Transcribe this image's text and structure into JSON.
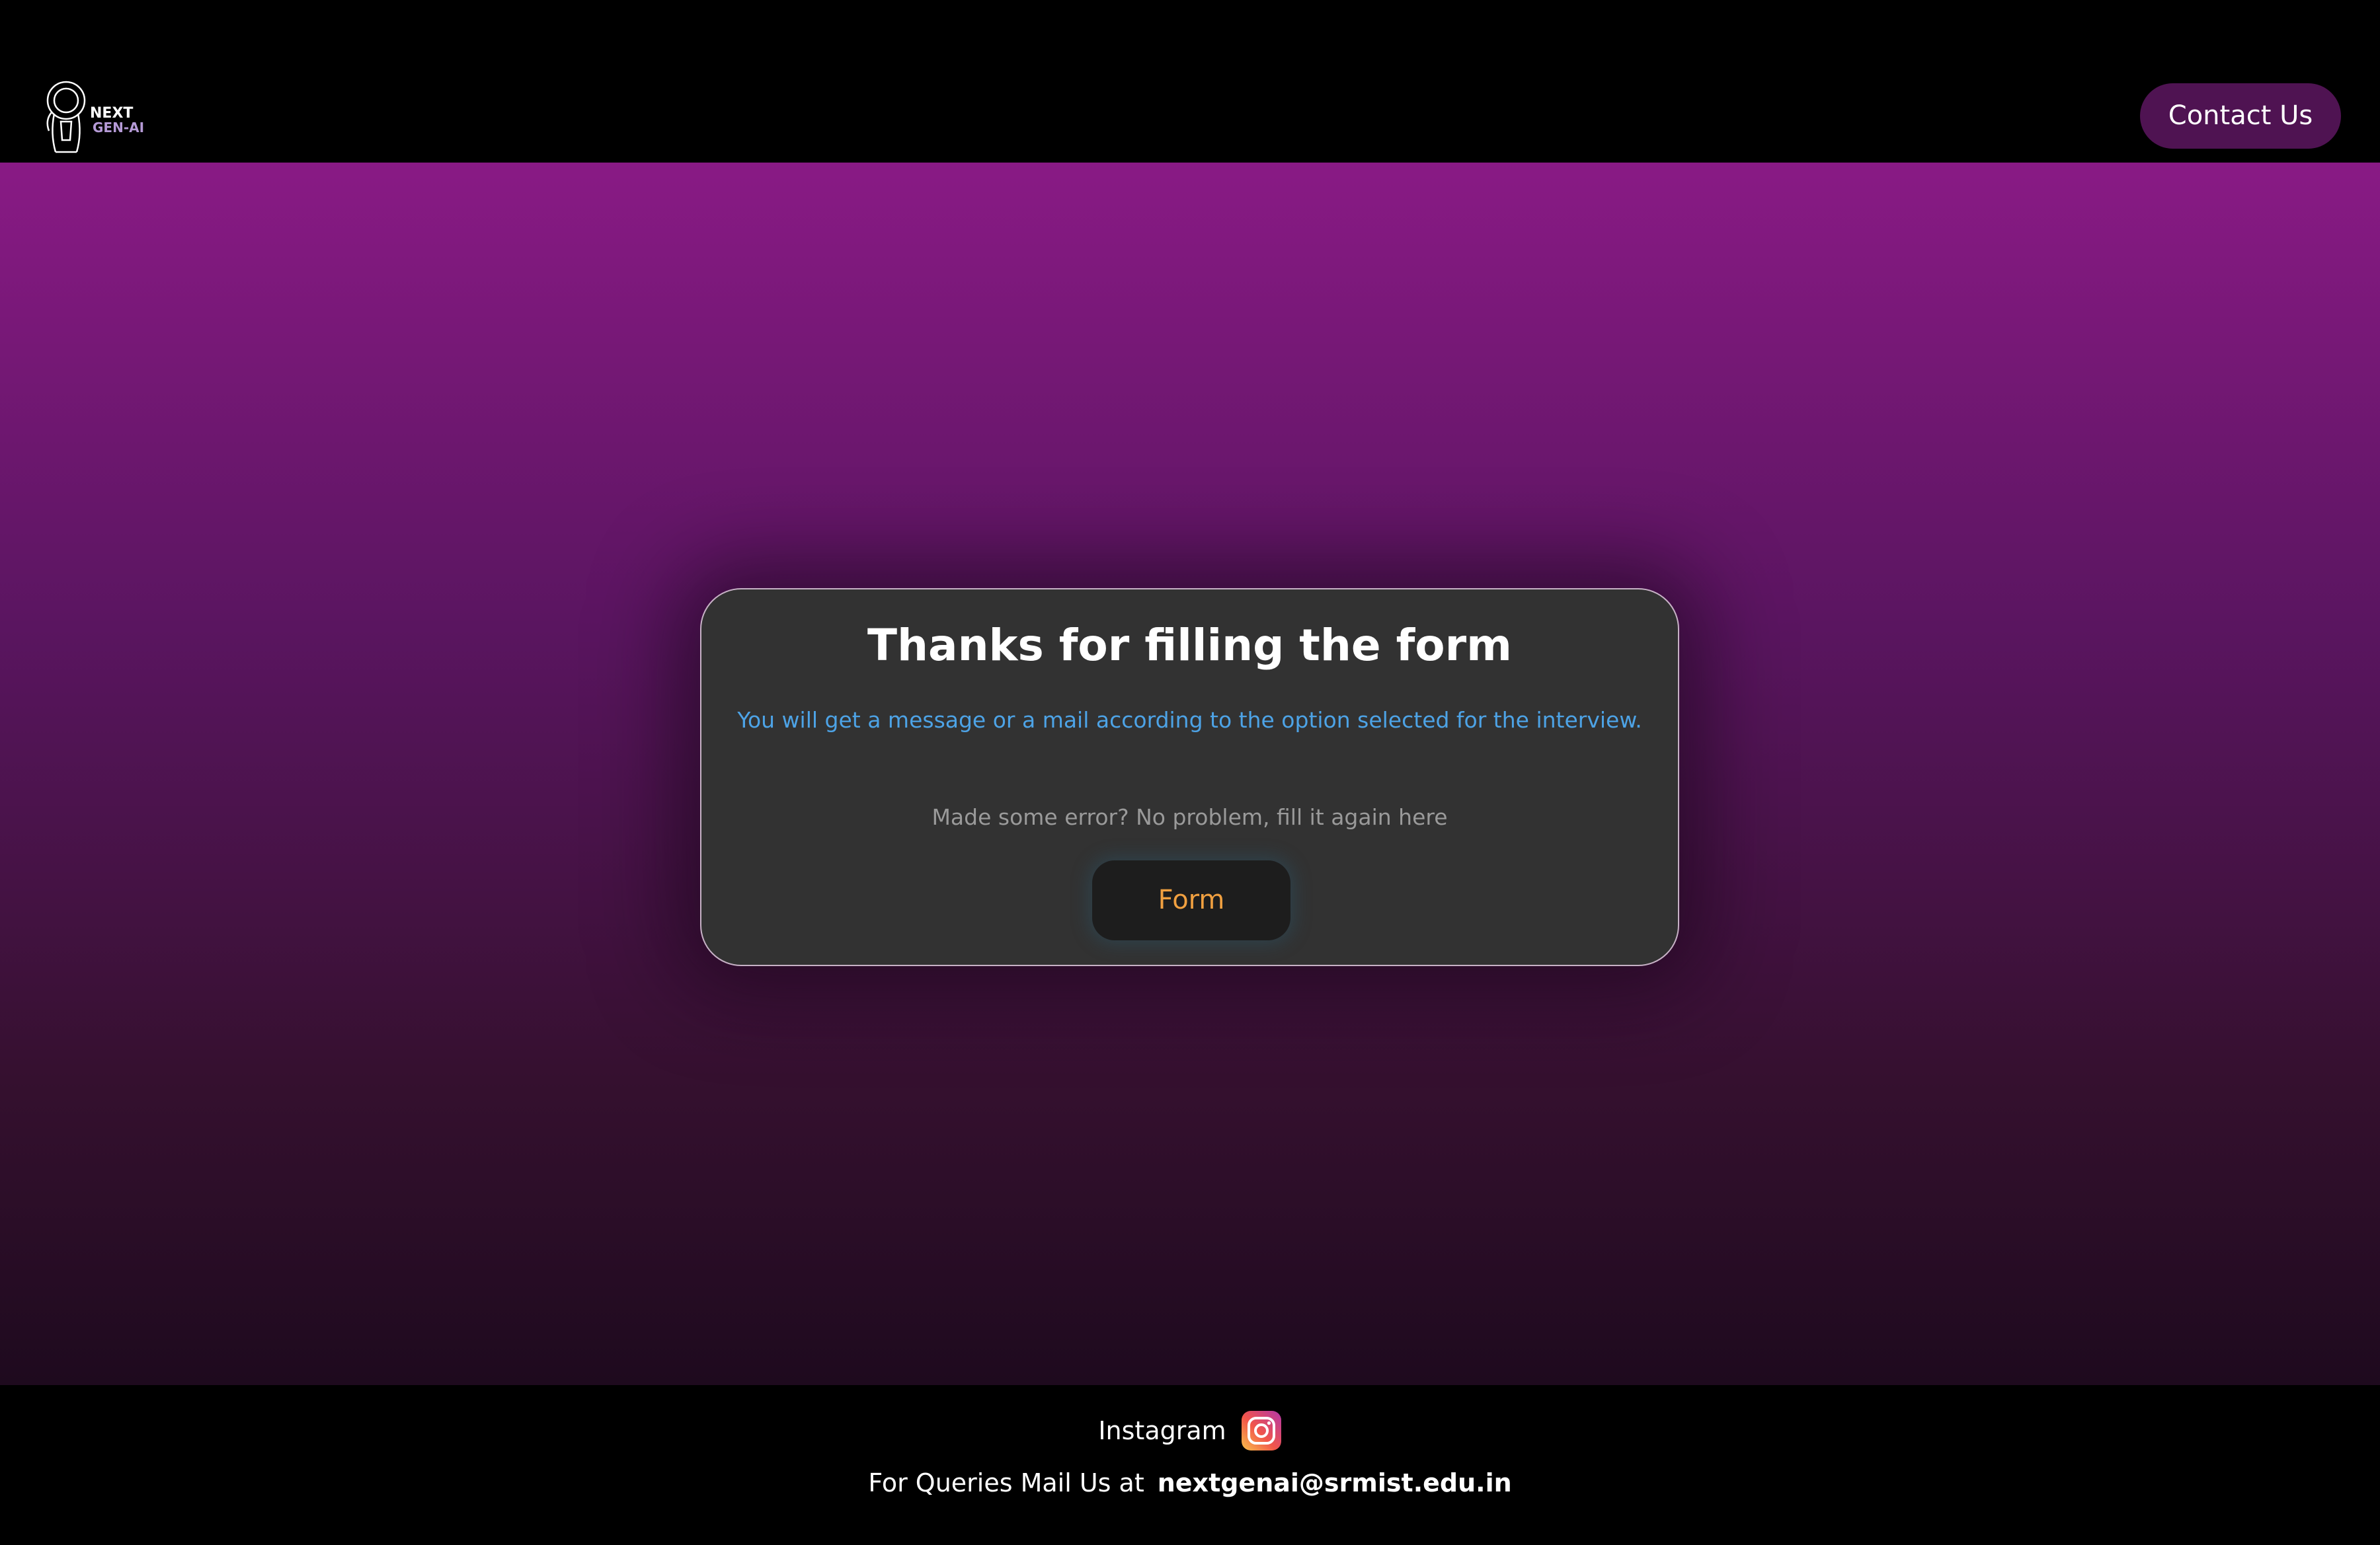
{
  "header": {
    "logo_text_top": "NEXT",
    "logo_text_bottom": "GEN-AI",
    "contact_label": "Contact Us",
    "colors": {
      "contact_bg": "#4f1352"
    }
  },
  "card": {
    "title": "Thanks for filling the form",
    "message": "You will get a message or a mail according to the option selected for the interview.",
    "hint": "Made some error? No problem, fill it again here",
    "form_button_label": "Form",
    "colors": {
      "message": "#4da3e6",
      "form_label": "#f0a040"
    }
  },
  "footer": {
    "instagram_label": "Instagram",
    "instagram_icon": "instagram-icon",
    "mail_prefix": "For Queries Mail Us at",
    "mail_address": "nextgenai@srmist.edu.in"
  }
}
